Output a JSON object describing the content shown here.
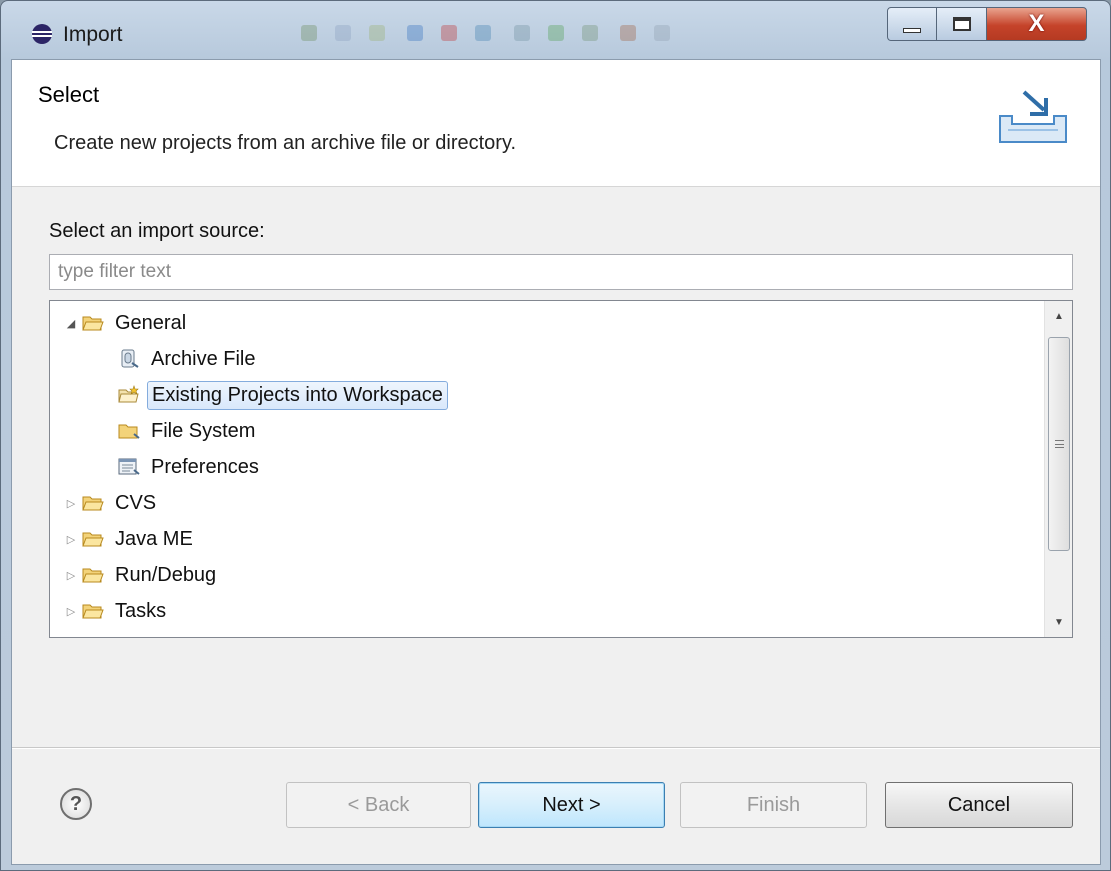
{
  "window": {
    "title": "Import"
  },
  "header": {
    "title": "Select",
    "description": "Create new projects from an archive file or directory."
  },
  "source": {
    "label": "Select an import source:",
    "filter_placeholder": "type filter text",
    "filter_value": ""
  },
  "tree": {
    "items": [
      {
        "label": "General",
        "icon": "folder-open-icon",
        "expanded": true
      },
      {
        "label": "Archive File",
        "icon": "archive-file-icon"
      },
      {
        "label": "Existing Projects into Workspace",
        "icon": "existing-projects-icon",
        "selected": true
      },
      {
        "label": "File System",
        "icon": "file-system-icon"
      },
      {
        "label": "Preferences",
        "icon": "preferences-icon"
      },
      {
        "label": "CVS",
        "icon": "folder-open-icon",
        "expanded": false
      },
      {
        "label": "Java ME",
        "icon": "folder-open-icon",
        "expanded": false
      },
      {
        "label": "Run/Debug",
        "icon": "folder-open-icon",
        "expanded": false
      },
      {
        "label": "Tasks",
        "icon": "folder-open-icon",
        "expanded": false
      }
    ]
  },
  "buttons": {
    "back": "< Back",
    "next": "Next >",
    "finish": "Finish",
    "cancel": "Cancel"
  },
  "colors": {
    "selection_border": "#84acdd",
    "default_button_border": "#3c7fb1",
    "close_button": "#c5432a"
  }
}
